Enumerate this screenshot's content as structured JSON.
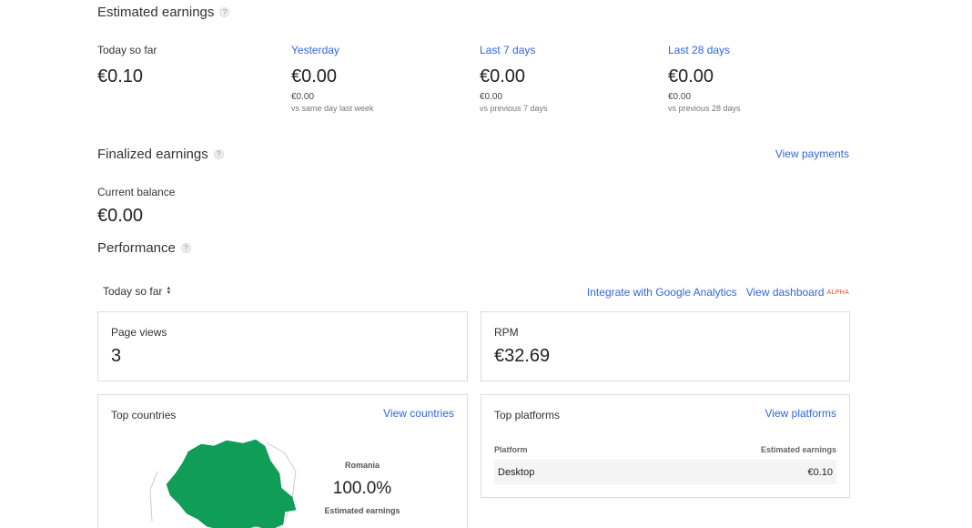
{
  "estimated": {
    "heading": "Estimated earnings",
    "help": "?",
    "stats": [
      {
        "label": "Today so far",
        "value": "€0.10",
        "sub": "",
        "compare": ""
      },
      {
        "label": "Yesterday",
        "value": "€0.00",
        "sub": "€0.00",
        "compare": "vs same day last week"
      },
      {
        "label": "Last 7 days",
        "value": "€0.00",
        "sub": "€0.00",
        "compare": "vs previous 7 days"
      },
      {
        "label": "Last 28 days",
        "value": "€0.00",
        "sub": "€0.00",
        "compare": "vs previous 28 days"
      }
    ]
  },
  "finalized": {
    "heading": "Finalized earnings",
    "help": "?",
    "view_payments": "View payments",
    "balance_label": "Current balance",
    "balance_value": "€0.00"
  },
  "performance": {
    "heading": "Performance",
    "help": "?",
    "range": "Today so far",
    "integrate_link": "Integrate with Google Analytics",
    "dashboard_link": "View dashboard",
    "dashboard_badge": "ALPHA",
    "page_views": {
      "title": "Page views",
      "value": "3"
    },
    "rpm": {
      "title": "RPM",
      "value": "€32.69"
    }
  },
  "top_countries": {
    "title": "Top countries",
    "link": "View countries",
    "country": "Romania",
    "percent": "100.0%",
    "metric": "Estimated earnings",
    "map_color": "#0f9d58"
  },
  "top_platforms": {
    "title": "Top platforms",
    "link": "View platforms",
    "columns": [
      "Platform",
      "Estimated earnings"
    ],
    "rows": [
      {
        "platform": "Desktop",
        "earnings": "€0.10"
      }
    ]
  },
  "colors": {
    "link": "#3367d6",
    "alpha_badge": "#dd4b39"
  }
}
